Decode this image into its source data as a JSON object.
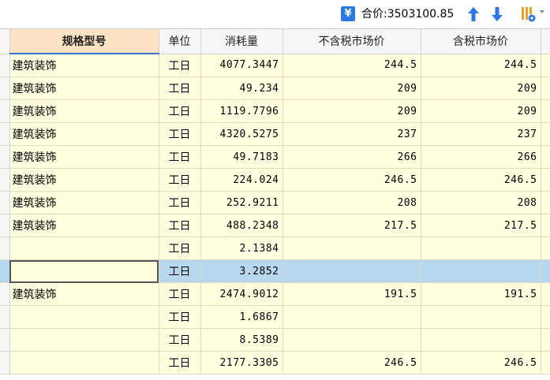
{
  "toolbar": {
    "total_label": "合价:3503100.85",
    "yen_icon": "yen-icon",
    "up_icon": "arrow-up-icon",
    "down_icon": "arrow-down-icon",
    "config_icon": "column-config-icon",
    "accent": "#2b78e4"
  },
  "table": {
    "headers": [
      "规格型号",
      "单位",
      "消耗量",
      "不含税市场价",
      "含税市场价"
    ],
    "rows": [
      {
        "spec": "建筑装饰",
        "unit": "工日",
        "qty": "4077.3447",
        "price_ex": "244.5",
        "price_in": "244.5"
      },
      {
        "spec": "建筑装饰",
        "unit": "工日",
        "qty": "49.234",
        "price_ex": "209",
        "price_in": "209"
      },
      {
        "spec": "建筑装饰",
        "unit": "工日",
        "qty": "1119.7796",
        "price_ex": "209",
        "price_in": "209"
      },
      {
        "spec": "建筑装饰",
        "unit": "工日",
        "qty": "4320.5275",
        "price_ex": "237",
        "price_in": "237"
      },
      {
        "spec": "建筑装饰",
        "unit": "工日",
        "qty": "49.7183",
        "price_ex": "266",
        "price_in": "266"
      },
      {
        "spec": "建筑装饰",
        "unit": "工日",
        "qty": "224.024",
        "price_ex": "246.5",
        "price_in": "246.5"
      },
      {
        "spec": "建筑装饰",
        "unit": "工日",
        "qty": "252.9211",
        "price_ex": "208",
        "price_in": "208"
      },
      {
        "spec": "建筑装饰",
        "unit": "工日",
        "qty": "488.2348",
        "price_ex": "217.5",
        "price_in": "217.5"
      },
      {
        "spec": "",
        "unit": "工日",
        "qty": "2.1384",
        "price_ex": "",
        "price_in": ""
      },
      {
        "spec": "",
        "unit": "工日",
        "qty": "3.2852",
        "price_ex": "",
        "price_in": ""
      },
      {
        "spec": "建筑装饰",
        "unit": "工日",
        "qty": "2474.9012",
        "price_ex": "191.5",
        "price_in": "191.5"
      },
      {
        "spec": "",
        "unit": "工日",
        "qty": "1.6867",
        "price_ex": "",
        "price_in": ""
      },
      {
        "spec": "",
        "unit": "工日",
        "qty": "8.5389",
        "price_ex": "",
        "price_in": ""
      },
      {
        "spec": "",
        "unit": "工日",
        "qty": "2177.3305",
        "price_ex": "246.5",
        "price_in": "246.5"
      }
    ],
    "active_row": 9,
    "colors": {
      "row_bg": "#ffffe0",
      "selected_row": "#b6d7ee",
      "selected_header": "#fde3c4"
    }
  }
}
